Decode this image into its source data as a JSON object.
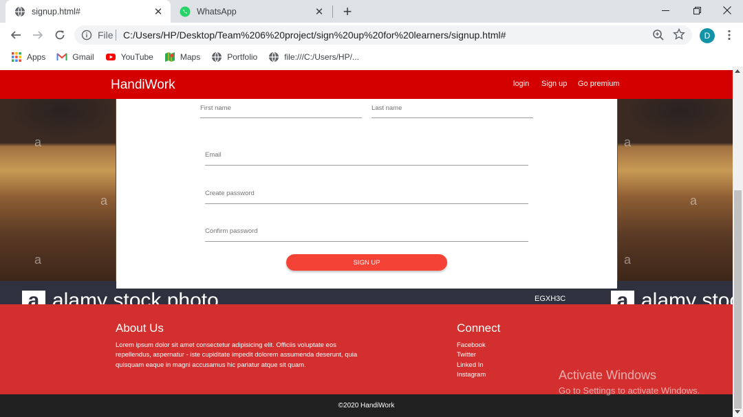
{
  "browser": {
    "tabs": [
      {
        "title": "signup.html#",
        "icon": "globe-icon",
        "active": true
      },
      {
        "title": "WhatsApp",
        "icon": "whatsapp-icon",
        "active": false
      }
    ],
    "omnibox": {
      "scheme": "File",
      "url": "C:/Users/HP/Desktop/Team%206%20project/sign%20up%20for%20learners/signup.html#"
    },
    "profile_initial": "D",
    "bookmarks": [
      {
        "label": "Apps",
        "icon": "apps-grid-icon"
      },
      {
        "label": "Gmail",
        "icon": "gmail-icon"
      },
      {
        "label": "YouTube",
        "icon": "youtube-icon"
      },
      {
        "label": "Maps",
        "icon": "maps-icon"
      },
      {
        "label": "Portfolio",
        "icon": "globe-icon"
      },
      {
        "label": "file:///C:/Users/HP/...",
        "icon": "globe-icon"
      }
    ]
  },
  "page": {
    "brand": "HandiWork",
    "nav": {
      "login": "login",
      "signup": "Sign up",
      "premium": "Go premium"
    },
    "form": {
      "first_name": "First name",
      "last_name": "Last name",
      "email": "Email",
      "create_password": "Create password",
      "confirm_password": "Confirm password",
      "submit": "SIGN UP"
    },
    "background": {
      "watermark": "a",
      "logo_text": "alamy stock photo",
      "image_code": "EGXH3C"
    },
    "footer": {
      "about_title": "About Us",
      "about_text": "Lorem ipsum dolor sit amet consectetur adipisicing elit. Officiis voluptate eos repellendus, aspernatur - iste cupiditate impedit dolorem assumenda deserunt, quia quisquam eaque in magni accusamus hic pariatur atque sit quam.",
      "connect_title": "Connect",
      "links": [
        "Facebook",
        "Twitter",
        "Linked In",
        "Instagram"
      ],
      "copyright": "©2020 HandiWork"
    }
  },
  "os_overlay": {
    "line1": "Activate Windows",
    "line2": "Go to Settings to activate Windows."
  },
  "colors": {
    "header": "#d40000",
    "footer": "#d32f2f",
    "button": "#f44336",
    "copyright_bar": "#212121"
  }
}
